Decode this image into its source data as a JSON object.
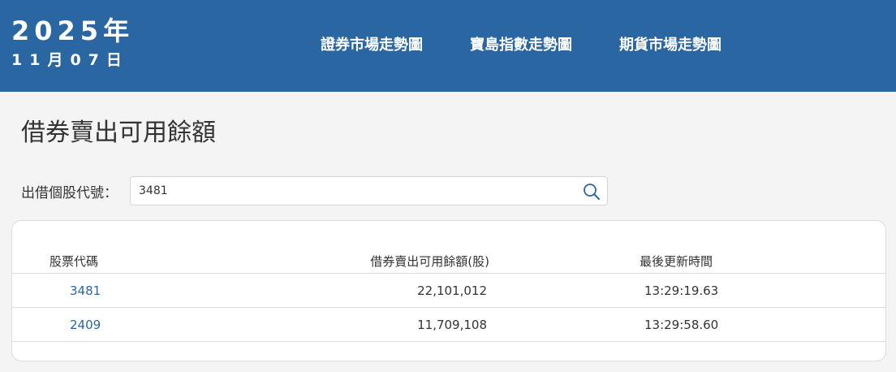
{
  "header": {
    "year": "2025年",
    "day": "11月07日",
    "nav": [
      {
        "label": "證券市場走勢圖"
      },
      {
        "label": "寶島指數走勢圖"
      },
      {
        "label": "期貨市場走勢圖"
      }
    ]
  },
  "page": {
    "title": "借券賣出可用餘額"
  },
  "search": {
    "label": "出借個股代號：",
    "value": "3481",
    "icon": "search-icon"
  },
  "table": {
    "columns": [
      "股票代碼",
      "借券賣出可用餘額(股)",
      "最後更新時間"
    ],
    "rows": [
      {
        "code": "3481",
        "quantity": "22,101,012",
        "updated": "13:29:19.63"
      },
      {
        "code": "2409",
        "quantity": "11,709,108",
        "updated": "13:29:58.60"
      }
    ]
  },
  "colors": {
    "header_bg": "#2a67a2",
    "link": "#2a67a2",
    "page_bg": "#f4f4f4"
  }
}
